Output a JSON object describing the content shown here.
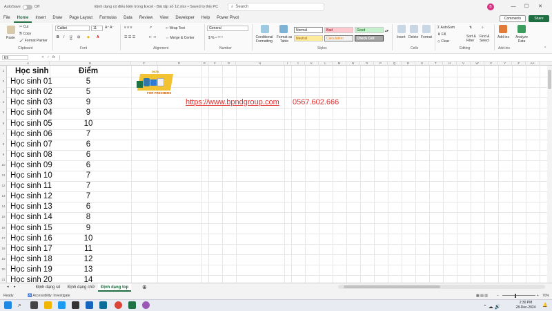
{
  "titlebar": {
    "autosave": "AutoSave",
    "off": "Off",
    "title": "Định dạng có điều kiện trong Excel - Bài tập số 12.xlsx • Saved to this PC",
    "search": "Search",
    "avatar": "B"
  },
  "menu": [
    "File",
    "Home",
    "Insert",
    "Draw",
    "Page Layout",
    "Formulas",
    "Data",
    "Review",
    "View",
    "Developer",
    "Help",
    "Power Pivot"
  ],
  "actions": {
    "comments": "Comments",
    "share": "Share"
  },
  "ribbon": {
    "clipboard": {
      "paste": "Paste",
      "cut": "Cut",
      "copy": "Copy",
      "format_painter": "Format Painter",
      "label": "Clipboard"
    },
    "font": {
      "name": "Calibri",
      "size": "11",
      "label": "Font"
    },
    "alignment": {
      "wrap": "Wrap Text",
      "merge": "Merge & Center",
      "label": "Alignment"
    },
    "number": {
      "format": "General",
      "label": "Number"
    },
    "styles": {
      "cond": "Conditional Formatting",
      "table": "Format as Table",
      "normal": "Normal",
      "bad": "Bad",
      "good": "Good",
      "neutral": "Neutral",
      "calculation": "Calculation",
      "check": "Check Cell",
      "label": "Styles"
    },
    "cells": {
      "insert": "Insert",
      "delete": "Delete",
      "format": "Format",
      "label": "Cells"
    },
    "editing": {
      "autosum": "AutoSum",
      "fill": "Fill",
      "clear": "Clear",
      "sort": "Sort & Filter",
      "find": "Find & Select",
      "label": "Editing"
    },
    "addins": {
      "addins": "Add-ins",
      "analyze": "Analyze Data",
      "label": "Add-ins"
    }
  },
  "namebox": "E9",
  "fx": "fx",
  "columns": [
    "A",
    "B",
    "C",
    "D",
    "E",
    "F",
    "G",
    "H",
    "I",
    "J",
    "K",
    "L",
    "M",
    "N",
    "O",
    "P",
    "Q",
    "R",
    "S",
    "T",
    "U",
    "V",
    "W",
    "X",
    "Y",
    "Z",
    "AA"
  ],
  "table": {
    "header": [
      "Học sinh",
      "Điểm"
    ],
    "rows": [
      [
        "Học sinh 01",
        "5"
      ],
      [
        "Học sinh 02",
        "5"
      ],
      [
        "Học sinh 03",
        "9"
      ],
      [
        "Học sinh 04",
        "9"
      ],
      [
        "Học sinh 05",
        "10"
      ],
      [
        "Học sinh 06",
        "7"
      ],
      [
        "Học sinh 07",
        "6"
      ],
      [
        "Học sinh 08",
        "6"
      ],
      [
        "Học sinh 09",
        "6"
      ],
      [
        "Học sinh 10",
        "7"
      ],
      [
        "Học sinh 11",
        "7"
      ],
      [
        "Học sinh 12",
        "7"
      ],
      [
        "Học sinh 13",
        "6"
      ],
      [
        "Học sinh 14",
        "8"
      ],
      [
        "Học sinh 15",
        "9"
      ],
      [
        "Học sinh 16",
        "10"
      ],
      [
        "Học sinh 17",
        "11"
      ],
      [
        "Học sinh 18",
        "12"
      ],
      [
        "Học sinh 19",
        "13"
      ],
      [
        "Học sinh 20",
        "14"
      ]
    ]
  },
  "link": "https://www.bpndgroup.com",
  "phone": "0567.602.666",
  "logo_text": {
    "top": "DATA",
    "bottom": "FOR FRESHERS"
  },
  "sheets": [
    "Định dạng số",
    "Định dạng chữ",
    "Định dạng top"
  ],
  "status": {
    "ready": "Ready",
    "accessibility": "Accessibility: Investigate",
    "zoom": "70%"
  },
  "clock": {
    "time": "2:30 PM",
    "date": "28-Dec-2024"
  },
  "colors": {
    "excel_green": "#1e6e42",
    "link_red": "#e03030"
  }
}
